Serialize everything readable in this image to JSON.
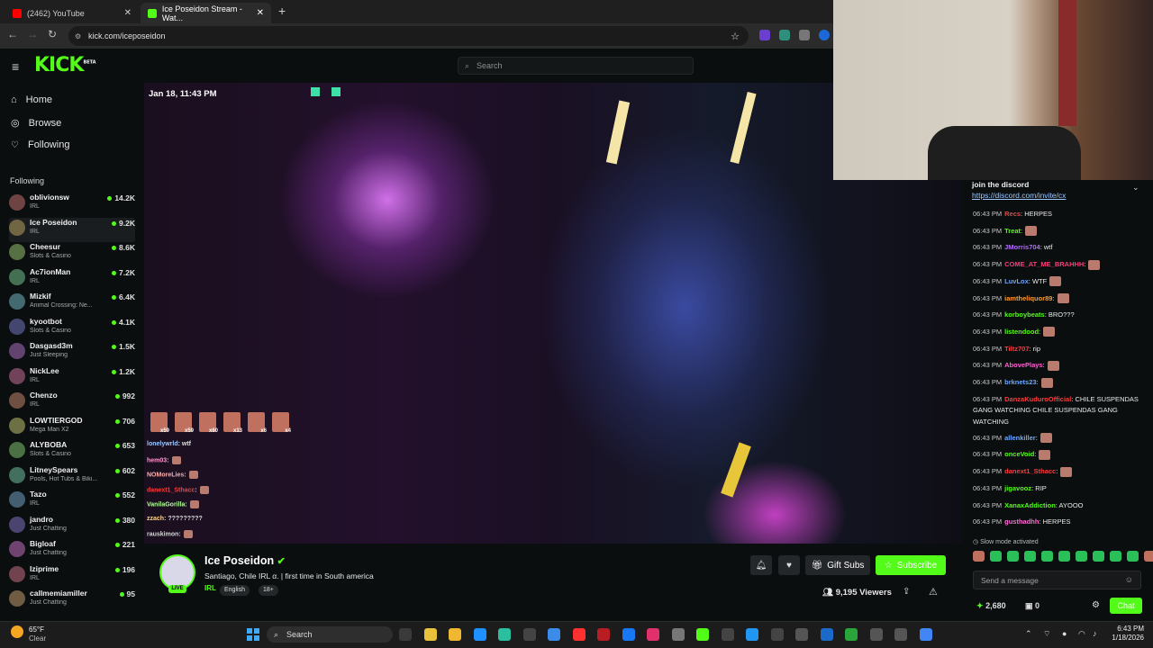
{
  "browser": {
    "tabs": [
      {
        "title": "(2462) YouTube",
        "active": false
      },
      {
        "title": "Ice Poseidon Stream - Wat...",
        "active": true
      }
    ],
    "url": "kick.com/iceposeidon"
  },
  "kick": {
    "logo": "KICK",
    "logo_badge": "BETA",
    "search_placeholder": "Search",
    "nav": [
      {
        "label": "Home",
        "icon": "home-icon"
      },
      {
        "label": "Browse",
        "icon": "compass-icon"
      },
      {
        "label": "Following",
        "icon": "heart-icon"
      }
    ],
    "following_header": "Following",
    "following": [
      {
        "name": "oblivionsw",
        "category": "IRL",
        "viewers": "14.2K"
      },
      {
        "name": "Ice Poseidon",
        "category": "IRL",
        "viewers": "9.2K"
      },
      {
        "name": "Cheesur",
        "category": "Slots & Casino",
        "viewers": "8.6K"
      },
      {
        "name": "Ac7ionMan",
        "category": "IRL",
        "viewers": "7.2K"
      },
      {
        "name": "Mizkif",
        "category": "Animal Crossing: Ne...",
        "viewers": "6.4K"
      },
      {
        "name": "kyootbot",
        "category": "Slots & Casino",
        "viewers": "4.1K"
      },
      {
        "name": "Dasgasd3m",
        "category": "Just Sleeping",
        "viewers": "1.5K"
      },
      {
        "name": "NickLee",
        "category": "IRL",
        "viewers": "1.2K"
      },
      {
        "name": "Chenzo",
        "category": "IRL",
        "viewers": "992"
      },
      {
        "name": "LOWTIERGOD",
        "category": "Mega Man X2",
        "viewers": "706"
      },
      {
        "name": "ALYBOBA",
        "category": "Slots & Casino",
        "viewers": "653"
      },
      {
        "name": "LitneySpears",
        "category": "Pools, Hot Tubs & Biki...",
        "viewers": "602"
      },
      {
        "name": "Tazo",
        "category": "IRL",
        "viewers": "552"
      },
      {
        "name": "jandro",
        "category": "Just Chatting",
        "viewers": "380"
      },
      {
        "name": "Bigloaf",
        "category": "Just Chatting",
        "viewers": "221"
      },
      {
        "name": "Iziprime",
        "category": "IRL",
        "viewers": "196"
      },
      {
        "name": "callmemiamiller",
        "category": "Just Chatting",
        "viewers": "95"
      }
    ],
    "video": {
      "timestamp": "Jan 18, 11:43 PM",
      "overlay_badges": [
        "x59",
        "x59",
        "x60",
        "x13",
        "x6",
        "x4"
      ],
      "overlay_chat": [
        {
          "user": "lonelywrld",
          "text": ": wtf"
        },
        {
          "user": "hem03",
          "text": ":"
        },
        {
          "user": "NOMoreLies",
          "text": ":"
        },
        {
          "user": "danext1_Sthacc",
          "text": ":"
        },
        {
          "user": "VanilaGorilla",
          "text": ":"
        },
        {
          "user": "zzach",
          "text": ": ?????????"
        },
        {
          "user": "rauskimon",
          "text": ":"
        }
      ]
    },
    "stream": {
      "streamer": "Ice Poseidon",
      "live_label": "LIVE",
      "title": "Santiago, Chile IRL α. | first time in South america",
      "tags": [
        "IRL",
        "English",
        "18+"
      ],
      "viewers": "9,195 Viewers",
      "gift_label": "Gift Subs",
      "subscribe_label": "Subscribe"
    },
    "chat": {
      "pinned_title": "join the discord",
      "pinned_link": "https://discord.com/invite/cx",
      "messages": [
        {
          "time": "06:43 PM",
          "user": "Recs",
          "color": "#e04848",
          "text": ": HERPES",
          "emote": false
        },
        {
          "time": "06:43 PM",
          "user": "Treat",
          "color": "#53fc18",
          "text": ":",
          "emote": true
        },
        {
          "time": "06:43 PM",
          "user": "JMorris704",
          "color": "#b36bff",
          "text": ": wtf",
          "emote": false
        },
        {
          "time": "06:43 PM",
          "user": "COME_AT_ME_BRAHHH",
          "color": "#ff3b7a",
          "text": ":",
          "emote": true
        },
        {
          "time": "06:43 PM",
          "user": "LuvLox",
          "color": "#6aa8ff",
          "text": ": WTF",
          "emote": true
        },
        {
          "time": "06:43 PM",
          "user": "iamtheliquor89",
          "color": "#ff9a2e",
          "text": ":",
          "emote": true
        },
        {
          "time": "06:43 PM",
          "user": "korboybeats",
          "color": "#53fc18",
          "text": ": BRO???",
          "emote": false
        },
        {
          "time": "06:43 PM",
          "user": "listendood",
          "color": "#53fc18",
          "text": ":",
          "emote": true
        },
        {
          "time": "06:43 PM",
          "user": "Tiltz707",
          "color": "#ff3b3b",
          "text": ": rip",
          "emote": false
        },
        {
          "time": "06:43 PM",
          "user": "AbovePlays",
          "color": "#ff5fd2",
          "text": ":",
          "emote": true
        },
        {
          "time": "06:43 PM",
          "user": "brknets23",
          "color": "#6aa8ff",
          "text": ":",
          "emote": true
        },
        {
          "time": "06:43 PM",
          "user": "DanzaKuduroOfficial",
          "color": "#ff3b3b",
          "text": ": CHILE SUSPENDAS GANG WATCHING CHILE SUSPENDAS GANG WATCHING",
          "emote": false
        },
        {
          "time": "06:43 PM",
          "user": "allenkiller",
          "color": "#6aa8ff",
          "text": ":",
          "emote": true
        },
        {
          "time": "06:43 PM",
          "user": "onceVoid",
          "color": "#53fc18",
          "text": ":",
          "emote": true
        },
        {
          "time": "06:43 PM",
          "user": "danext1_Sthacc",
          "color": "#ff3b3b",
          "text": ":",
          "emote": true
        },
        {
          "time": "06:43 PM",
          "user": "jigavooz",
          "color": "#53fc18",
          "text": ": RIP",
          "emote": false
        },
        {
          "time": "06:43 PM",
          "user": "XanaxAddiction",
          "color": "#53fc18",
          "text": ": AYOOO",
          "emote": false
        },
        {
          "time": "06:43 PM",
          "user": "gusthadhh",
          "color": "#ff6ad5",
          "text": ": HERPES",
          "emote": false
        }
      ],
      "slow_mode": "Slow mode activated",
      "input_placeholder": "Send a message",
      "points": "2,680",
      "other_count": "0",
      "chat_button": "Chat"
    }
  },
  "taskbar": {
    "weather_temp": "65°F",
    "weather_desc": "Clear",
    "search_label": "Search",
    "time": "6:43 PM",
    "date": "1/18/2026"
  }
}
